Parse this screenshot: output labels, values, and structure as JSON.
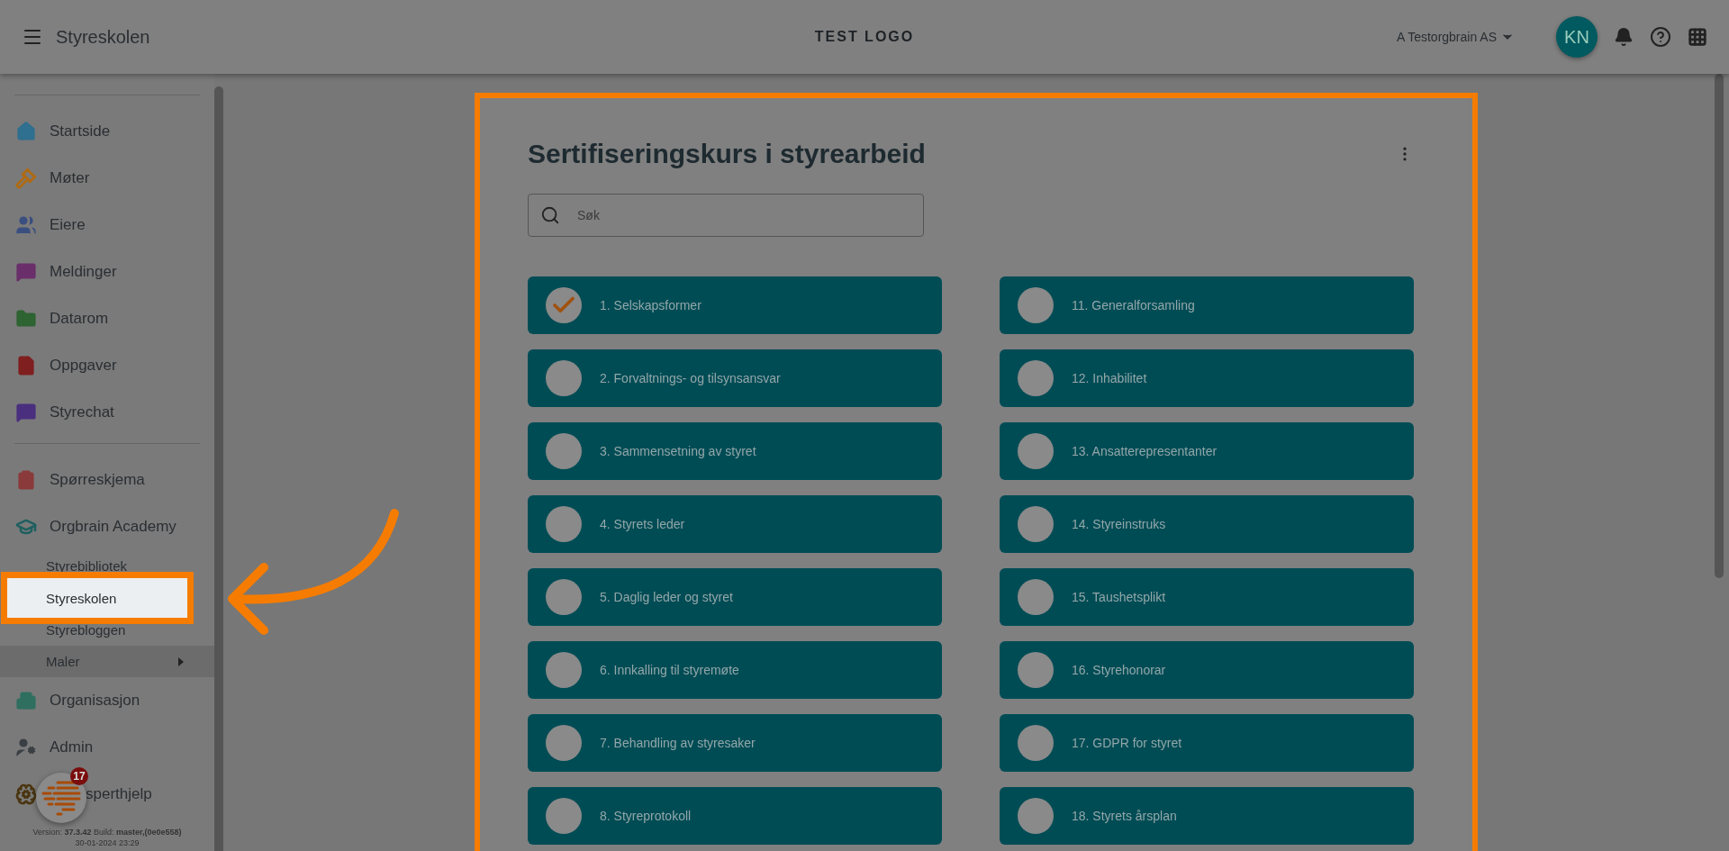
{
  "header": {
    "title": "Styreskolen",
    "logo": "TEST LOGO",
    "organization": "A Testorgbrain AS",
    "avatar": "KN"
  },
  "sidebar": {
    "groups": [
      {
        "items": [
          {
            "label": "Startside",
            "color": "#2f6f8f",
            "selected": false
          },
          {
            "label": "Møter",
            "color": "#b06a10",
            "selected": false
          },
          {
            "label": "Eiere",
            "color": "#3a4f7f",
            "selected": false
          },
          {
            "label": "Meldinger",
            "color": "#6a2f6a",
            "selected": false
          },
          {
            "label": "Datarom",
            "color": "#2e6332",
            "selected": false
          },
          {
            "label": "Oppgaver",
            "color": "#7f1f1f",
            "selected": false
          },
          {
            "label": "Styrechat",
            "color": "#4a2f7f",
            "selected": false
          }
        ]
      },
      {
        "items": [
          {
            "label": "Spørreskjema",
            "color": "#8a3a3a",
            "selected": false
          },
          {
            "label": "Orgbrain Academy",
            "color": "#1f5f5f",
            "selected": false,
            "children": [
              {
                "label": "Styrebibliotek",
                "kind": "link",
                "selected": false
              },
              {
                "label": "Styreskolen",
                "kind": "link",
                "selected": true
              },
              {
                "label": "Styrebloggen",
                "kind": "link",
                "selected": false
              },
              {
                "label": "Maler",
                "kind": "submenu",
                "selected": false
              }
            ]
          },
          {
            "label": "Organisasjon",
            "color": "#2f6f5f",
            "selected": false
          },
          {
            "label": "Admin",
            "color": "#3a3f44",
            "selected": false
          },
          {
            "label": "sperthjelp",
            "color": "#4a3510",
            "selected": false
          }
        ]
      }
    ],
    "chat_badge": "17",
    "version": "Version: **37.3.42** Build: **master,(0e0e558)**",
    "date": "30-01-2024 23:29"
  },
  "course": {
    "title": "Sertifiseringskurs i styrearbeid",
    "search": {
      "placeholder": "Søk"
    },
    "left_column": [
      {
        "label": "1. Selskapsformer",
        "done": true
      },
      {
        "label": "2. Forvaltnings- og tilsynsansvar",
        "done": false
      },
      {
        "label": "3. Sammensetning av styret",
        "done": false
      },
      {
        "label": "4. Styrets leder",
        "done": false
      },
      {
        "label": "5. Daglig leder og styret",
        "done": false
      },
      {
        "label": "6. Innkalling til styremøte",
        "done": false
      },
      {
        "label": "7. Behandling av styresaker",
        "done": false
      },
      {
        "label": "8. Styreprotokoll",
        "done": false
      }
    ],
    "right_column": [
      {
        "label": "11. Generalforsamling",
        "done": false
      },
      {
        "label": "12. Inhabilitet",
        "done": false
      },
      {
        "label": "13. Ansatterepresentanter",
        "done": false
      },
      {
        "label": "14. Styreinstruks",
        "done": false
      },
      {
        "label": "15. Taushetsplikt",
        "done": false
      },
      {
        "label": "16. Styrehonorar",
        "done": false
      },
      {
        "label": "17. GDPR for styret",
        "done": false
      },
      {
        "label": "18. Styrets årsplan",
        "done": false
      }
    ]
  }
}
